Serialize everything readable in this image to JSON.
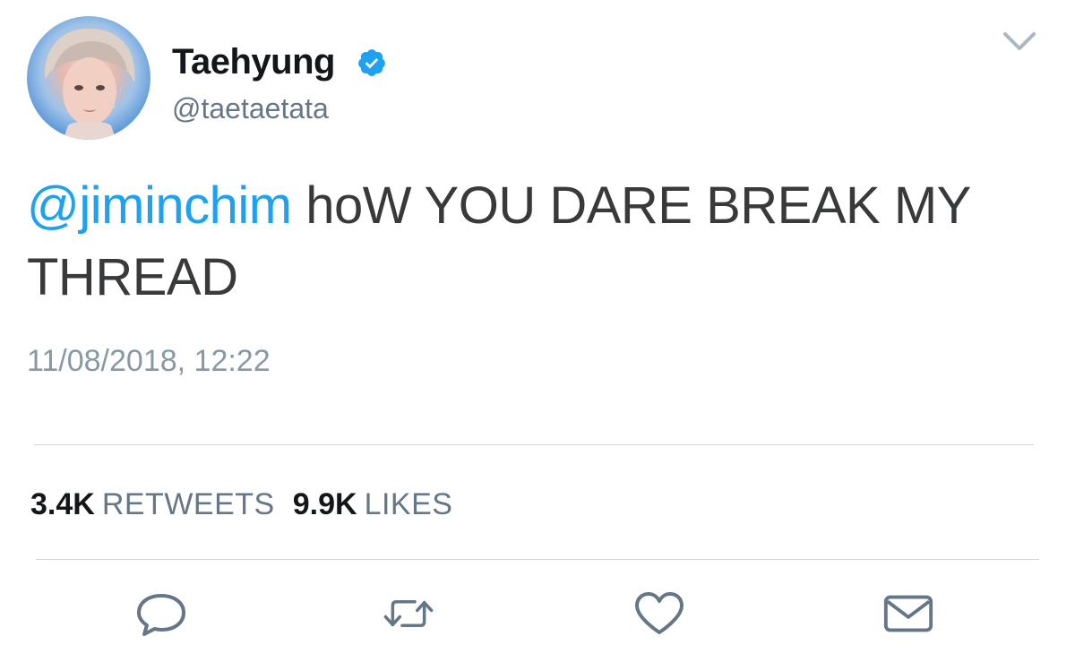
{
  "user": {
    "display_name": "Taehyung",
    "handle": "@taetaetata",
    "verified": true,
    "avatar_icon": "profile-photo"
  },
  "tweet": {
    "mention": "@jiminchim",
    "text": " hoW YOU DARE BREAK MY THREAD",
    "timestamp": "11/08/2018, 12:22"
  },
  "stats": {
    "retweets_count": "3.4K",
    "retweets_label": "RETWEETS",
    "likes_count": "9.9K",
    "likes_label": "LIKES"
  },
  "actions": {
    "reply_icon": "reply-icon",
    "retweet_icon": "retweet-icon",
    "like_icon": "heart-icon",
    "dm_icon": "envelope-icon"
  },
  "colors": {
    "link": "#1da1f2",
    "text": "#38393b",
    "muted": "#657786",
    "divider": "#d0d6db",
    "verified": "#1da1f2"
  }
}
